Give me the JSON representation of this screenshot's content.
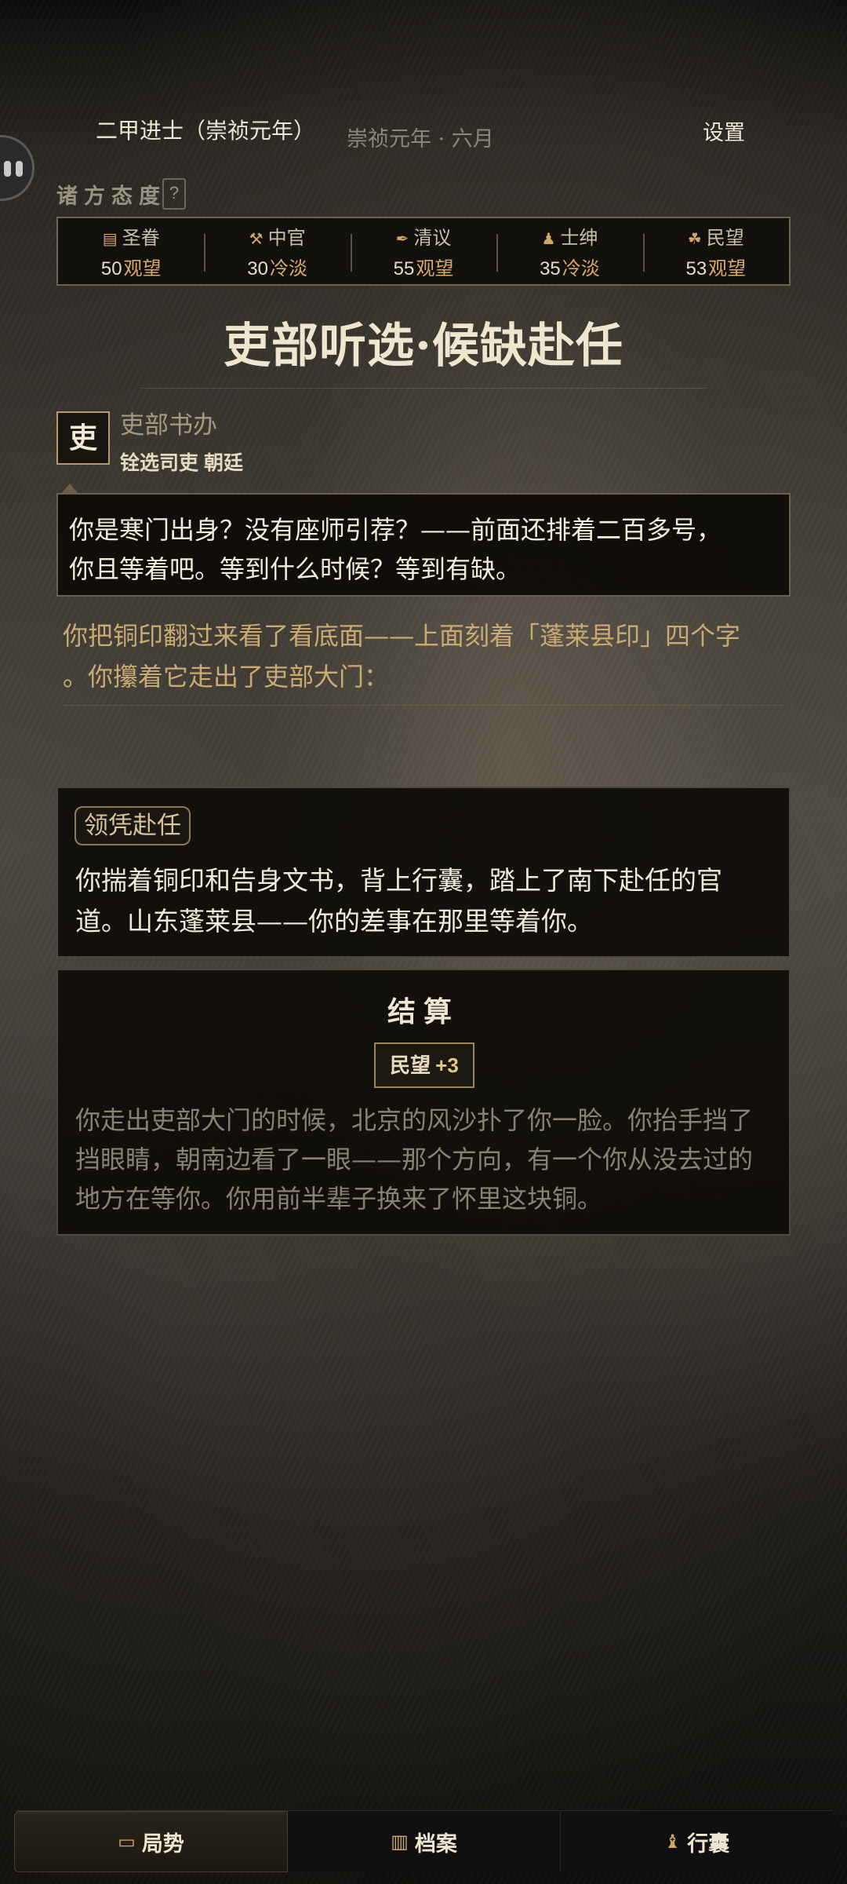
{
  "header": {
    "rank": "二甲进士（崇祯元年）",
    "date": "崇祯元年 · 六月",
    "settings_label": "设置"
  },
  "attitudes": {
    "title": "诸方态度",
    "help": "?",
    "items": [
      {
        "icon": "imperial-scroll-icon",
        "name": "圣眷",
        "value": "50",
        "status": "观望"
      },
      {
        "icon": "eunuch-icon",
        "name": "中官",
        "value": "30",
        "status": "冷淡"
      },
      {
        "icon": "scholar-icon",
        "name": "清议",
        "value": "55",
        "status": "观望"
      },
      {
        "icon": "gentry-icon",
        "name": "士绅",
        "value": "35",
        "status": "冷淡"
      },
      {
        "icon": "people-icon",
        "name": "民望",
        "value": "53",
        "status": "观望"
      }
    ]
  },
  "scene": {
    "title": "吏部听选·候缺赴任"
  },
  "speaker": {
    "badge": "吏",
    "name": "吏部书办",
    "subtitle": "铨选司吏 朝廷",
    "dialog_line1": "你是寒门出身？没有座师引荐？——前面还排着二百多号，",
    "dialog_line2": "你且等着吧。等到什么时候？等到有缺。"
  },
  "narration": {
    "line1": "你把铜印翻过来看了看底面——上面刻着「蓬莱县印」四个字",
    "line2": "。你攥着它走出了吏部大门："
  },
  "choice": {
    "tag": "领凭赴任",
    "line1": "你揣着铜印和告身文书，背上行囊，踏上了南下赴任的官",
    "line2": "道。山东蓬莱县——你的差事在那里等着你。"
  },
  "settlement": {
    "title": "结算",
    "effect_name": "民望",
    "effect_value": "+3",
    "line1": "你走出吏部大门的时候，北京的风沙扑了你一脸。你抬手挡了",
    "line2": "挡眼睛，朝南边看了一眼——那个方向，有一个你从没去过的",
    "line3": "地方在等你。你用前半辈子换来了怀里这块铜。"
  },
  "nav": {
    "items": [
      {
        "icon": "map-icon",
        "label": "局势",
        "active": true
      },
      {
        "icon": "archive-icon",
        "label": "档案",
        "active": false
      },
      {
        "icon": "bag-icon",
        "label": "行囊",
        "active": false
      }
    ]
  }
}
